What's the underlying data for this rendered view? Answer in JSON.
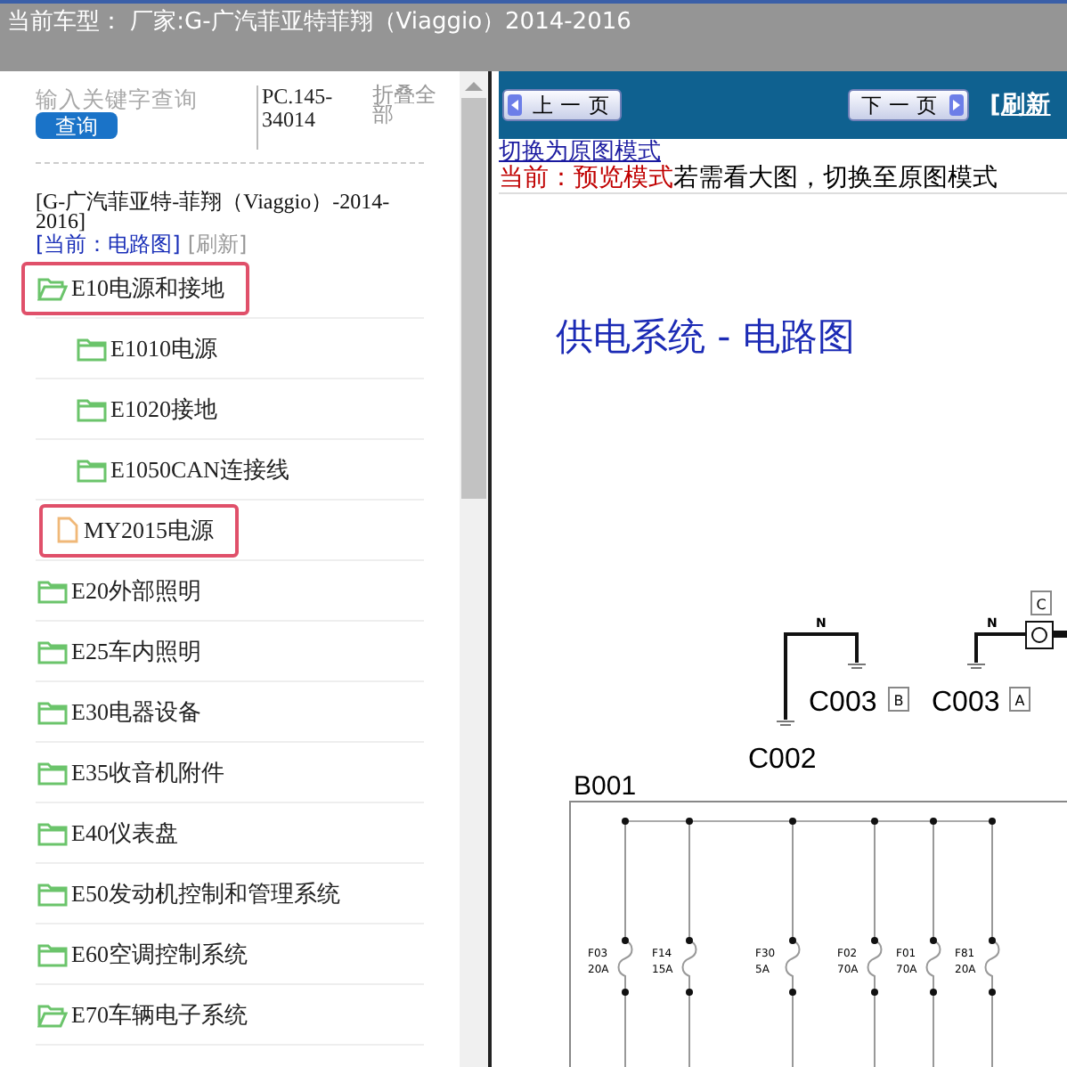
{
  "header": {
    "title": "当前车型： 厂家:G-广汽菲亚特菲翔（Viaggio）2014-2016"
  },
  "sidebar": {
    "search": {
      "placeholder": "输入关键字查询",
      "button": "查询"
    },
    "part_code": "PC.145-34014",
    "collapse_all": "折叠全部",
    "model": "[G-广汽菲亚特-菲翔（Viaggio）-2014-2016]",
    "current": "[当前：电路图]",
    "refresh": "[刷新]",
    "tree": [
      {
        "label": "E10电源和接地",
        "kind": "folder",
        "expanded": true,
        "highlighted": true,
        "children": [
          {
            "label": "E1010电源",
            "kind": "folder",
            "expanded": false,
            "highlighted": false
          },
          {
            "label": "E1020接地",
            "kind": "folder",
            "expanded": false,
            "highlighted": false
          },
          {
            "label": "E1050CAN连接线",
            "kind": "folder",
            "expanded": false,
            "highlighted": false
          },
          {
            "label": "MY2015电源",
            "kind": "file",
            "expanded": false,
            "highlighted": true
          }
        ]
      },
      {
        "label": "E20外部照明",
        "kind": "folder",
        "expanded": false,
        "highlighted": false
      },
      {
        "label": "E25车内照明",
        "kind": "folder",
        "expanded": false,
        "highlighted": false
      },
      {
        "label": "E30电器设备",
        "kind": "folder",
        "expanded": false,
        "highlighted": false
      },
      {
        "label": "E35收音机附件",
        "kind": "folder",
        "expanded": false,
        "highlighted": false
      },
      {
        "label": "E40仪表盘",
        "kind": "folder",
        "expanded": false,
        "highlighted": false
      },
      {
        "label": "E50发动机控制和管理系统",
        "kind": "folder",
        "expanded": false,
        "highlighted": false
      },
      {
        "label": "E60空调控制系统",
        "kind": "folder",
        "expanded": false,
        "highlighted": false
      },
      {
        "label": "E70车辆电子系统",
        "kind": "folder",
        "expanded": true,
        "highlighted": false
      }
    ]
  },
  "viewer": {
    "prev_button": "上 一 页",
    "next_button": "下 一 页",
    "refresh_link": "[刷新",
    "switch_link": "切换为原图模式",
    "mode_status": "当前：预览模式",
    "mode_hint": "若需看大图，切换至原图模式",
    "diagram": {
      "title": "供电系统 - 电路图",
      "wire_codes": [
        "N",
        "N"
      ],
      "pins": [
        "C",
        "B",
        "A"
      ],
      "connectors": [
        "C003",
        "C003",
        "C002"
      ],
      "box_label": "B001",
      "fuses": [
        {
          "name": "F03",
          "rating": "20A"
        },
        {
          "name": "F14",
          "rating": "15A"
        },
        {
          "name": "F30",
          "rating": "5A"
        },
        {
          "name": "F02",
          "rating": "70A"
        },
        {
          "name": "F01",
          "rating": "70A"
        },
        {
          "name": "F81",
          "rating": "20A"
        }
      ]
    }
  }
}
